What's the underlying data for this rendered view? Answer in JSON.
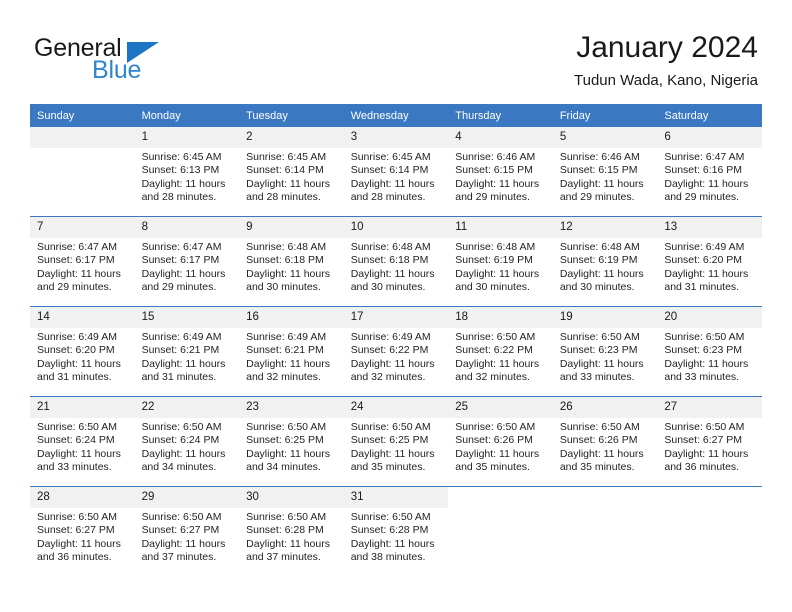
{
  "brand": {
    "name_part1": "General",
    "name_part2": "Blue",
    "flag_icon": "blue-flag-triangle",
    "colors": {
      "blue": "#2f86cd",
      "flag_blue": "#1c76c4",
      "dark": "#1a1a1a"
    }
  },
  "header": {
    "title": "January 2024",
    "subtitle": "Tudun Wada, Kano, Nigeria"
  },
  "theme": {
    "header_row_bg": "#3a78c2",
    "daynum_bg": "#f1f1f1",
    "separator": "#3a78c2",
    "text": "#231f20"
  },
  "labels": {
    "sunrise_prefix": "Sunrise:",
    "sunset_prefix": "Sunset:",
    "daylight_prefix": "Daylight:"
  },
  "columns": [
    "Sunday",
    "Monday",
    "Tuesday",
    "Wednesday",
    "Thursday",
    "Friday",
    "Saturday"
  ],
  "weeks": [
    [
      {
        "day": "",
        "empty": true,
        "sunrise": "",
        "sunset": "",
        "daylight": ""
      },
      {
        "day": "1",
        "sunrise": "Sunrise: 6:45 AM",
        "sunset": "Sunset: 6:13 PM",
        "daylight": "Daylight: 11 hours and 28 minutes."
      },
      {
        "day": "2",
        "sunrise": "Sunrise: 6:45 AM",
        "sunset": "Sunset: 6:14 PM",
        "daylight": "Daylight: 11 hours and 28 minutes."
      },
      {
        "day": "3",
        "sunrise": "Sunrise: 6:45 AM",
        "sunset": "Sunset: 6:14 PM",
        "daylight": "Daylight: 11 hours and 28 minutes."
      },
      {
        "day": "4",
        "sunrise": "Sunrise: 6:46 AM",
        "sunset": "Sunset: 6:15 PM",
        "daylight": "Daylight: 11 hours and 29 minutes."
      },
      {
        "day": "5",
        "sunrise": "Sunrise: 6:46 AM",
        "sunset": "Sunset: 6:15 PM",
        "daylight": "Daylight: 11 hours and 29 minutes."
      },
      {
        "day": "6",
        "sunrise": "Sunrise: 6:47 AM",
        "sunset": "Sunset: 6:16 PM",
        "daylight": "Daylight: 11 hours and 29 minutes."
      }
    ],
    [
      {
        "day": "7",
        "sunrise": "Sunrise: 6:47 AM",
        "sunset": "Sunset: 6:17 PM",
        "daylight": "Daylight: 11 hours and 29 minutes."
      },
      {
        "day": "8",
        "sunrise": "Sunrise: 6:47 AM",
        "sunset": "Sunset: 6:17 PM",
        "daylight": "Daylight: 11 hours and 29 minutes."
      },
      {
        "day": "9",
        "sunrise": "Sunrise: 6:48 AM",
        "sunset": "Sunset: 6:18 PM",
        "daylight": "Daylight: 11 hours and 30 minutes."
      },
      {
        "day": "10",
        "sunrise": "Sunrise: 6:48 AM",
        "sunset": "Sunset: 6:18 PM",
        "daylight": "Daylight: 11 hours and 30 minutes."
      },
      {
        "day": "11",
        "sunrise": "Sunrise: 6:48 AM",
        "sunset": "Sunset: 6:19 PM",
        "daylight": "Daylight: 11 hours and 30 minutes."
      },
      {
        "day": "12",
        "sunrise": "Sunrise: 6:48 AM",
        "sunset": "Sunset: 6:19 PM",
        "daylight": "Daylight: 11 hours and 30 minutes."
      },
      {
        "day": "13",
        "sunrise": "Sunrise: 6:49 AM",
        "sunset": "Sunset: 6:20 PM",
        "daylight": "Daylight: 11 hours and 31 minutes."
      }
    ],
    [
      {
        "day": "14",
        "sunrise": "Sunrise: 6:49 AM",
        "sunset": "Sunset: 6:20 PM",
        "daylight": "Daylight: 11 hours and 31 minutes."
      },
      {
        "day": "15",
        "sunrise": "Sunrise: 6:49 AM",
        "sunset": "Sunset: 6:21 PM",
        "daylight": "Daylight: 11 hours and 31 minutes."
      },
      {
        "day": "16",
        "sunrise": "Sunrise: 6:49 AM",
        "sunset": "Sunset: 6:21 PM",
        "daylight": "Daylight: 11 hours and 32 minutes."
      },
      {
        "day": "17",
        "sunrise": "Sunrise: 6:49 AM",
        "sunset": "Sunset: 6:22 PM",
        "daylight": "Daylight: 11 hours and 32 minutes."
      },
      {
        "day": "18",
        "sunrise": "Sunrise: 6:50 AM",
        "sunset": "Sunset: 6:22 PM",
        "daylight": "Daylight: 11 hours and 32 minutes."
      },
      {
        "day": "19",
        "sunrise": "Sunrise: 6:50 AM",
        "sunset": "Sunset: 6:23 PM",
        "daylight": "Daylight: 11 hours and 33 minutes."
      },
      {
        "day": "20",
        "sunrise": "Sunrise: 6:50 AM",
        "sunset": "Sunset: 6:23 PM",
        "daylight": "Daylight: 11 hours and 33 minutes."
      }
    ],
    [
      {
        "day": "21",
        "sunrise": "Sunrise: 6:50 AM",
        "sunset": "Sunset: 6:24 PM",
        "daylight": "Daylight: 11 hours and 33 minutes."
      },
      {
        "day": "22",
        "sunrise": "Sunrise: 6:50 AM",
        "sunset": "Sunset: 6:24 PM",
        "daylight": "Daylight: 11 hours and 34 minutes."
      },
      {
        "day": "23",
        "sunrise": "Sunrise: 6:50 AM",
        "sunset": "Sunset: 6:25 PM",
        "daylight": "Daylight: 11 hours and 34 minutes."
      },
      {
        "day": "24",
        "sunrise": "Sunrise: 6:50 AM",
        "sunset": "Sunset: 6:25 PM",
        "daylight": "Daylight: 11 hours and 35 minutes."
      },
      {
        "day": "25",
        "sunrise": "Sunrise: 6:50 AM",
        "sunset": "Sunset: 6:26 PM",
        "daylight": "Daylight: 11 hours and 35 minutes."
      },
      {
        "day": "26",
        "sunrise": "Sunrise: 6:50 AM",
        "sunset": "Sunset: 6:26 PM",
        "daylight": "Daylight: 11 hours and 35 minutes."
      },
      {
        "day": "27",
        "sunrise": "Sunrise: 6:50 AM",
        "sunset": "Sunset: 6:27 PM",
        "daylight": "Daylight: 11 hours and 36 minutes."
      }
    ],
    [
      {
        "day": "28",
        "sunrise": "Sunrise: 6:50 AM",
        "sunset": "Sunset: 6:27 PM",
        "daylight": "Daylight: 11 hours and 36 minutes."
      },
      {
        "day": "29",
        "sunrise": "Sunrise: 6:50 AM",
        "sunset": "Sunset: 6:27 PM",
        "daylight": "Daylight: 11 hours and 37 minutes."
      },
      {
        "day": "30",
        "sunrise": "Sunrise: 6:50 AM",
        "sunset": "Sunset: 6:28 PM",
        "daylight": "Daylight: 11 hours and 37 minutes."
      },
      {
        "day": "31",
        "sunrise": "Sunrise: 6:50 AM",
        "sunset": "Sunset: 6:28 PM",
        "daylight": "Daylight: 11 hours and 38 minutes."
      },
      {
        "day": "",
        "blank": true,
        "sunrise": "",
        "sunset": "",
        "daylight": ""
      },
      {
        "day": "",
        "blank": true,
        "sunrise": "",
        "sunset": "",
        "daylight": ""
      },
      {
        "day": "",
        "blank": true,
        "sunrise": "",
        "sunset": "",
        "daylight": ""
      }
    ]
  ]
}
